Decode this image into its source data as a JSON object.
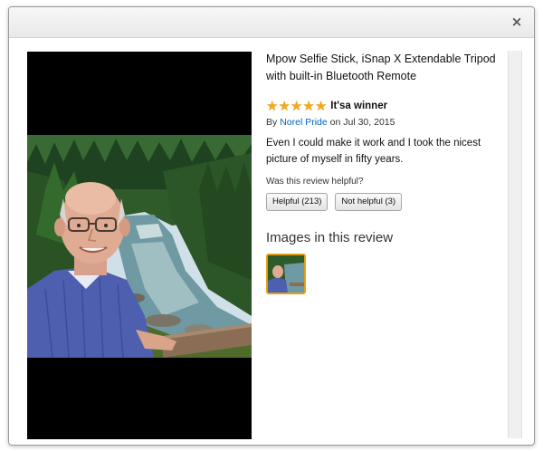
{
  "dialog": {
    "close_label": "×"
  },
  "product": {
    "title": "Mpow Selfie Stick, iSnap X Extendable Tripod with built-in Bluetooth Remote"
  },
  "review": {
    "rating": 5,
    "rating_max": 5,
    "title": "It'sa winner",
    "by_prefix": "By",
    "author": "Norel Pride",
    "date_prefix": "on",
    "date": "Jul 30, 2015",
    "body": "Even I could make it work and I took the nicest picture of myself in fifty years."
  },
  "helpful": {
    "question": "Was this review helpful?",
    "helpful_label": "Helpful (213)",
    "not_helpful_label": "Not helpful (3)"
  },
  "images_section": {
    "heading": "Images in this review"
  },
  "colors": {
    "star": "#f4a81d",
    "link": "#0066c0",
    "thumb_border": "#e59f10"
  }
}
